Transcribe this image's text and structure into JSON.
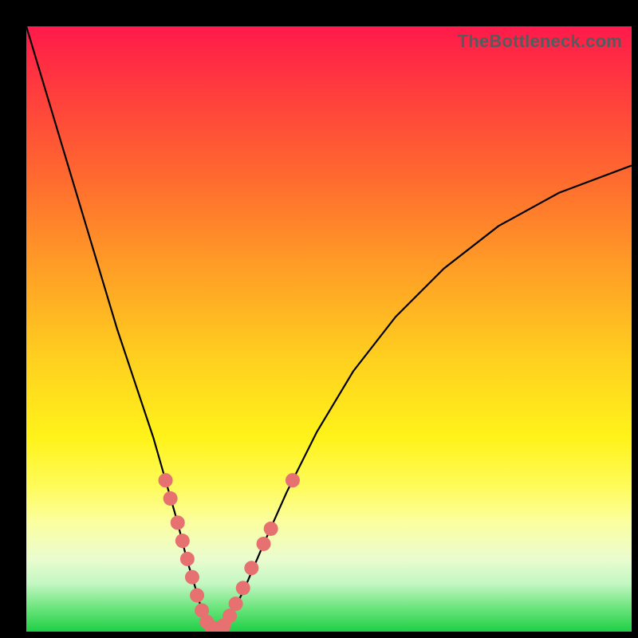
{
  "watermark": "TheBottleneck.com",
  "colors": {
    "dot": "#e77070",
    "curve": "#000000",
    "frame": "#000000"
  },
  "chart_data": {
    "type": "line",
    "title": "",
    "xlabel": "",
    "ylabel": "",
    "xlim": [
      0,
      100
    ],
    "ylim": [
      0,
      100
    ],
    "annotations": [
      "TheBottleneck.com"
    ],
    "series": [
      {
        "name": "bottleneck-curve",
        "x": [
          0,
          3,
          6,
          9,
          12,
          15,
          18,
          21,
          23,
          25,
          26.5,
          28,
          29,
          30,
          31,
          32.5,
          34,
          36,
          39,
          43,
          48,
          54,
          61,
          69,
          78,
          88,
          100
        ],
        "y": [
          100,
          90,
          80,
          70,
          60,
          50,
          41,
          32,
          25,
          18,
          12,
          7,
          3.5,
          1.2,
          0.4,
          1.0,
          3.0,
          7,
          14,
          23,
          33,
          43,
          52,
          60,
          67,
          72.5,
          77
        ]
      }
    ],
    "points": [
      {
        "name": "left-arm-top",
        "x": 23.0,
        "y": 25.0
      },
      {
        "name": "left-arm-2",
        "x": 23.8,
        "y": 22.0
      },
      {
        "name": "left-arm-3",
        "x": 25.0,
        "y": 18.0
      },
      {
        "name": "left-arm-4",
        "x": 25.8,
        "y": 15.0
      },
      {
        "name": "left-arm-5",
        "x": 26.6,
        "y": 12.0
      },
      {
        "name": "left-arm-6",
        "x": 27.4,
        "y": 9.0
      },
      {
        "name": "left-arm-7",
        "x": 28.2,
        "y": 6.0
      },
      {
        "name": "left-arm-8",
        "x": 29.0,
        "y": 3.5
      },
      {
        "name": "valley-1",
        "x": 29.8,
        "y": 1.6
      },
      {
        "name": "valley-2",
        "x": 30.6,
        "y": 0.7
      },
      {
        "name": "valley-3",
        "x": 31.6,
        "y": 0.5
      },
      {
        "name": "valley-4",
        "x": 32.6,
        "y": 1.0
      },
      {
        "name": "right-arm-1",
        "x": 33.6,
        "y": 2.6
      },
      {
        "name": "right-arm-2",
        "x": 34.6,
        "y": 4.6
      },
      {
        "name": "right-arm-3",
        "x": 35.8,
        "y": 7.2
      },
      {
        "name": "right-arm-4",
        "x": 37.2,
        "y": 10.5
      },
      {
        "name": "right-arm-5",
        "x": 39.2,
        "y": 14.5
      },
      {
        "name": "right-arm-6",
        "x": 40.4,
        "y": 17.0
      },
      {
        "name": "right-arm-top",
        "x": 44.0,
        "y": 25.0
      }
    ],
    "dot_radius_px": 9
  }
}
